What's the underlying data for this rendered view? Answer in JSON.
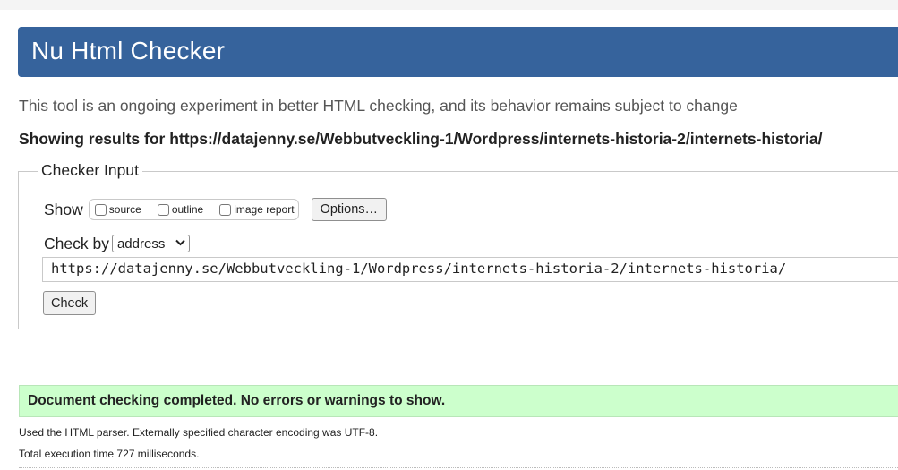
{
  "header": {
    "title": "Nu Html Checker",
    "color": "#36639c"
  },
  "intro": {
    "subtitle": "This tool is an ongoing experiment in better HTML checking, and its behavior remains subject to change",
    "showing_results": "Showing results for https://datajenny.se/Webbutveckling-1/Wordpress/internets-historia-2/internets-historia/"
  },
  "checker_input": {
    "legend": "Checker Input",
    "show_label": "Show",
    "show_options": [
      {
        "label": "source",
        "checked": false
      },
      {
        "label": "outline",
        "checked": false
      },
      {
        "label": "image report",
        "checked": false
      }
    ],
    "options_button": "Options…",
    "check_by_label": "Check by",
    "check_by_selected": "address",
    "url_value": "https://datajenny.se/Webbutveckling-1/Wordpress/internets-historia-2/internets-historia/",
    "check_button": "Check"
  },
  "result": {
    "message": "Document checking completed. No errors or warnings to show.",
    "color": "#ccffcc",
    "parser_info": "Used the HTML parser. Externally specified character encoding was UTF-8.",
    "execution_time": "Total execution time 727 milliseconds."
  },
  "icons": {
    "select_chevron": "chevron-down-icon"
  }
}
